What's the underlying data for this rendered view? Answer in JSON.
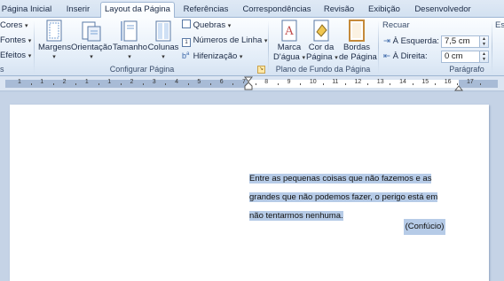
{
  "tabs": [
    "Página Inicial",
    "Inserir",
    "Layout da Página",
    "Referências",
    "Correspondências",
    "Revisão",
    "Exibição",
    "Desenvolvedor"
  ],
  "active_tab": "Layout da Página",
  "ribbon": {
    "temas": {
      "cores": "Cores",
      "fontes": "Fontes",
      "efeitos": "Efeitos"
    },
    "configurar_pagina": {
      "label": "Configurar Página",
      "margens": "Margens",
      "orientacao": "Orientação",
      "tamanho": "Tamanho",
      "colunas": "Colunas",
      "quebras": "Quebras",
      "numeros_linha": "Números de Linha",
      "hifenizacao": "Hifenização"
    },
    "plano_fundo": {
      "label": "Plano de Fundo da Página",
      "marca_dagua_1": "Marca",
      "marca_dagua_2": "D'água",
      "cor_pagina_1": "Cor da",
      "cor_pagina_2": "Página",
      "bordas_pagina_1": "Bordas",
      "bordas_pagina_2": "de Página"
    },
    "paragrafo": {
      "label": "Parágrafo",
      "recuar": "Recuar",
      "a_esquerda": "À Esquerda:",
      "a_esquerda_value": "7,5 cm",
      "a_direita": "À Direita:",
      "a_direita_value": "0 cm",
      "espacamento": "Esp"
    }
  },
  "ruler": {
    "numbers": [
      "1",
      "1",
      "2",
      "1",
      "1",
      "2",
      "3",
      "4",
      "5",
      "6",
      "7",
      "8",
      "9",
      "10",
      "11",
      "12",
      "13",
      "14",
      "15",
      "16",
      "17"
    ]
  },
  "document": {
    "quote_line1": "Entre as pequenas coisas que não fazemos e as",
    "quote_line2": "grandes que não podemos fazer, o perigo está em",
    "quote_line3": "não tentarmos nenhuma.",
    "author": "(Confúcio)"
  },
  "colors": {
    "ribbon_bg": "#e3edf8",
    "selection": "#b6cbe7",
    "doc_bg": "#c5d3e6"
  }
}
